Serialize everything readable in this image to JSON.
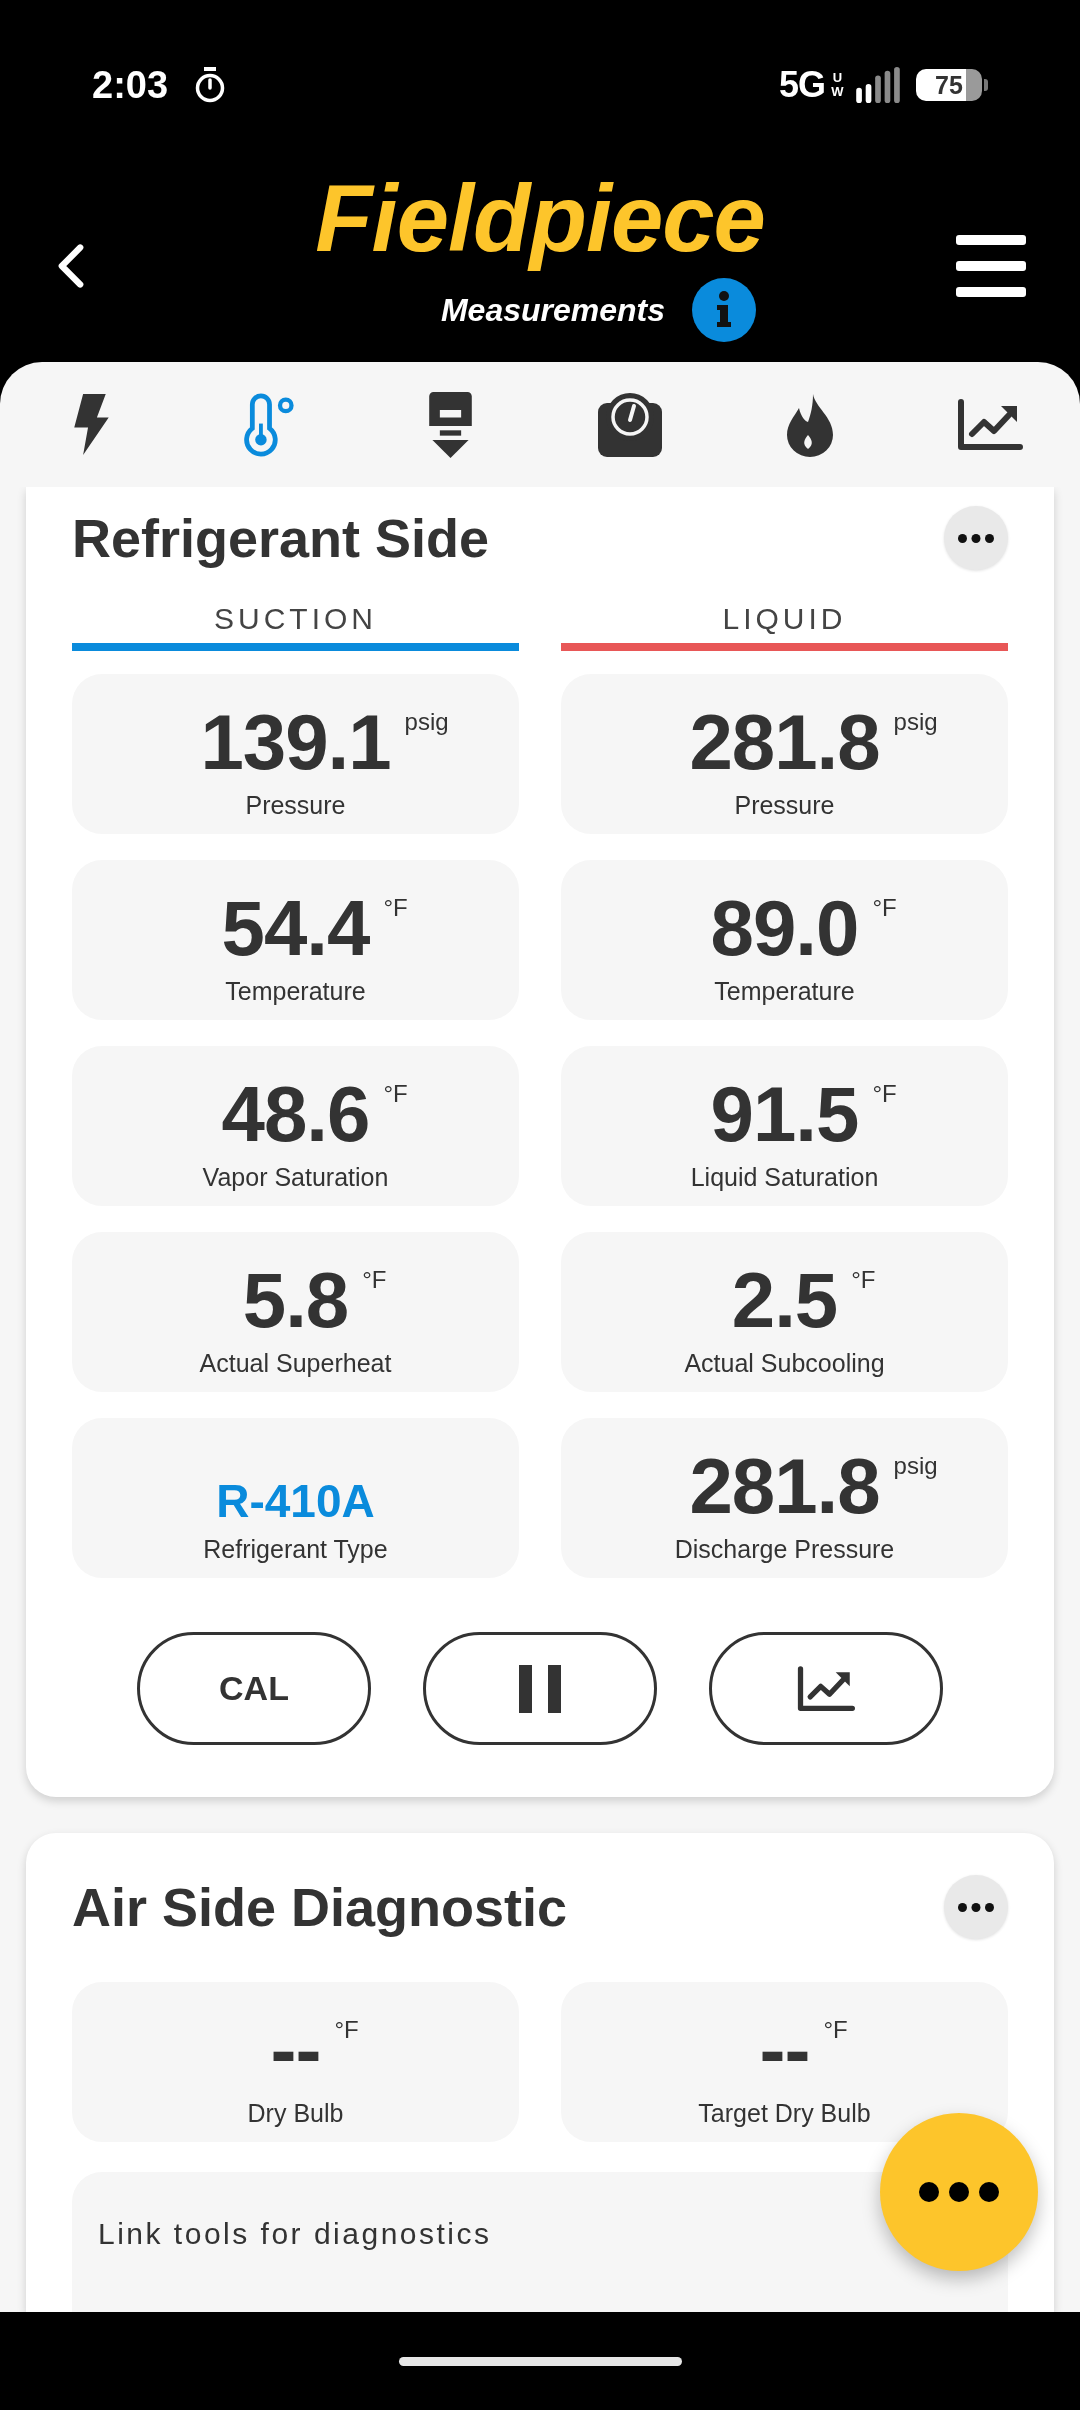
{
  "status_bar": {
    "time": "2:03",
    "network": "5G",
    "network_suffix": "UW",
    "battery": "75"
  },
  "header": {
    "logo": "Fieldpiece",
    "subtitle": "Measurements"
  },
  "tabs": [
    {
      "kind": "power",
      "selected": false
    },
    {
      "kind": "temperature",
      "selected": true
    },
    {
      "kind": "probe",
      "selected": false
    },
    {
      "kind": "gauge",
      "selected": false
    },
    {
      "kind": "flame",
      "selected": false
    },
    {
      "kind": "trend",
      "selected": false
    }
  ],
  "cards": [
    {
      "title": "Refrigerant Side",
      "columns": [
        {
          "label": "SUCTION",
          "color": "#0a8bdc"
        },
        {
          "label": "LIQUID",
          "color": "#e85757"
        }
      ],
      "rows": [
        [
          {
            "kind": "reading",
            "value": "139.1",
            "unit": "psig",
            "label": "Pressure"
          },
          {
            "kind": "reading",
            "value": "281.8",
            "unit": "psig",
            "label": "Pressure"
          }
        ],
        [
          {
            "kind": "reading",
            "value": "54.4",
            "unit": "°F",
            "label": "Temperature"
          },
          {
            "kind": "reading",
            "value": "89.0",
            "unit": "°F",
            "label": "Temperature"
          }
        ],
        [
          {
            "kind": "reading",
            "value": "48.6",
            "unit": "°F",
            "label": "Vapor Saturation"
          },
          {
            "kind": "reading",
            "value": "91.5",
            "unit": "°F",
            "label": "Liquid Saturation"
          }
        ],
        [
          {
            "kind": "reading",
            "value": "5.8",
            "unit": "°F",
            "label": "Actual Superheat"
          },
          {
            "kind": "reading",
            "value": "2.5",
            "unit": "°F",
            "label": "Actual Subcooling"
          }
        ],
        [
          {
            "kind": "text",
            "value": "R-410A",
            "label": "Refrigerant Type"
          },
          {
            "kind": "reading",
            "value": "281.8",
            "unit": "psig",
            "label": "Discharge Pressure"
          }
        ]
      ],
      "buttons": [
        {
          "kind": "text",
          "label": "CAL"
        },
        {
          "kind": "pause"
        },
        {
          "kind": "chart"
        }
      ]
    },
    {
      "title": "Air Side Diagnostic",
      "rows": [
        [
          {
            "kind": "reading",
            "value": "--",
            "unit": "°F",
            "label": "Dry Bulb"
          },
          {
            "kind": "reading",
            "value": "--",
            "unit": "°F",
            "label": "Target Dry Bulb"
          }
        ]
      ],
      "message": "Link tools for diagnostics"
    }
  ]
}
